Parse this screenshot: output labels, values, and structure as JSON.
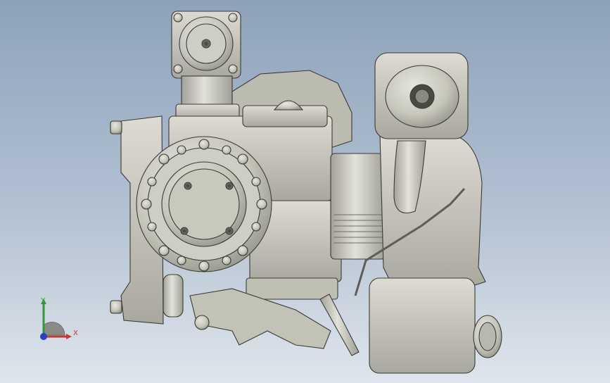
{
  "view": {
    "background_top": "#8da2ba",
    "background_bottom": "#dfe5ec",
    "part_color": "#c9c8bd",
    "edge_color": "#3a3a36"
  },
  "triad": {
    "x_label": "X",
    "y_label": "Y",
    "x_color": "#c43a2e",
    "y_color": "#2e9b3a",
    "z_color": "#2a3fc4"
  }
}
